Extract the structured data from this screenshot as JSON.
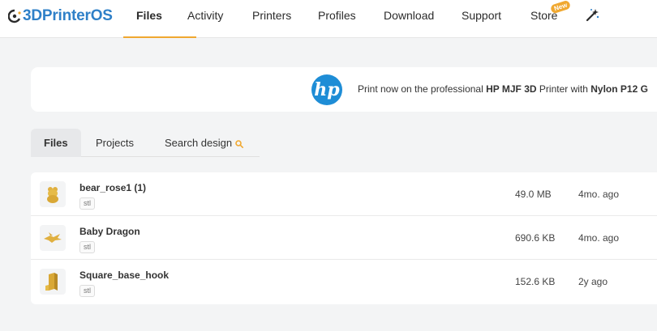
{
  "brand": {
    "name_prefix": "3D",
    "name_suffix": "PrinterOS",
    "icon": "printer-logo-icon"
  },
  "nav": {
    "items": [
      {
        "label": "Files",
        "active": true
      },
      {
        "label": "Activity"
      },
      {
        "label": "Printers"
      },
      {
        "label": "Profiles"
      },
      {
        "label": "Download"
      },
      {
        "label": "Support"
      },
      {
        "label": "Store",
        "badge": "New"
      }
    ],
    "magic_icon": "magic-wand-icon",
    "accent_color": "#f0a830"
  },
  "banner": {
    "logo_text": "hp",
    "text_pre": "Print now on the professional ",
    "text_bold1": "HP MJF 3D",
    "text_mid": " Printer with ",
    "text_bold2": "Nylon P12 G"
  },
  "tabs": [
    {
      "label": "Files",
      "active": true
    },
    {
      "label": "Projects"
    },
    {
      "label": "Search design",
      "icon": "search-icon"
    }
  ],
  "files": [
    {
      "name": "bear_rose1 (1)",
      "type": "stl",
      "size": "49.0 MB",
      "modified": "4mo. ago",
      "thumb": "bear-model-icon"
    },
    {
      "name": "Baby Dragon",
      "type": "stl",
      "size": "690.6 KB",
      "modified": "4mo. ago",
      "thumb": "dragon-model-icon"
    },
    {
      "name": "Square_base_hook",
      "type": "stl",
      "size": "152.6 KB",
      "modified": "2y ago",
      "thumb": "hook-model-icon"
    }
  ]
}
